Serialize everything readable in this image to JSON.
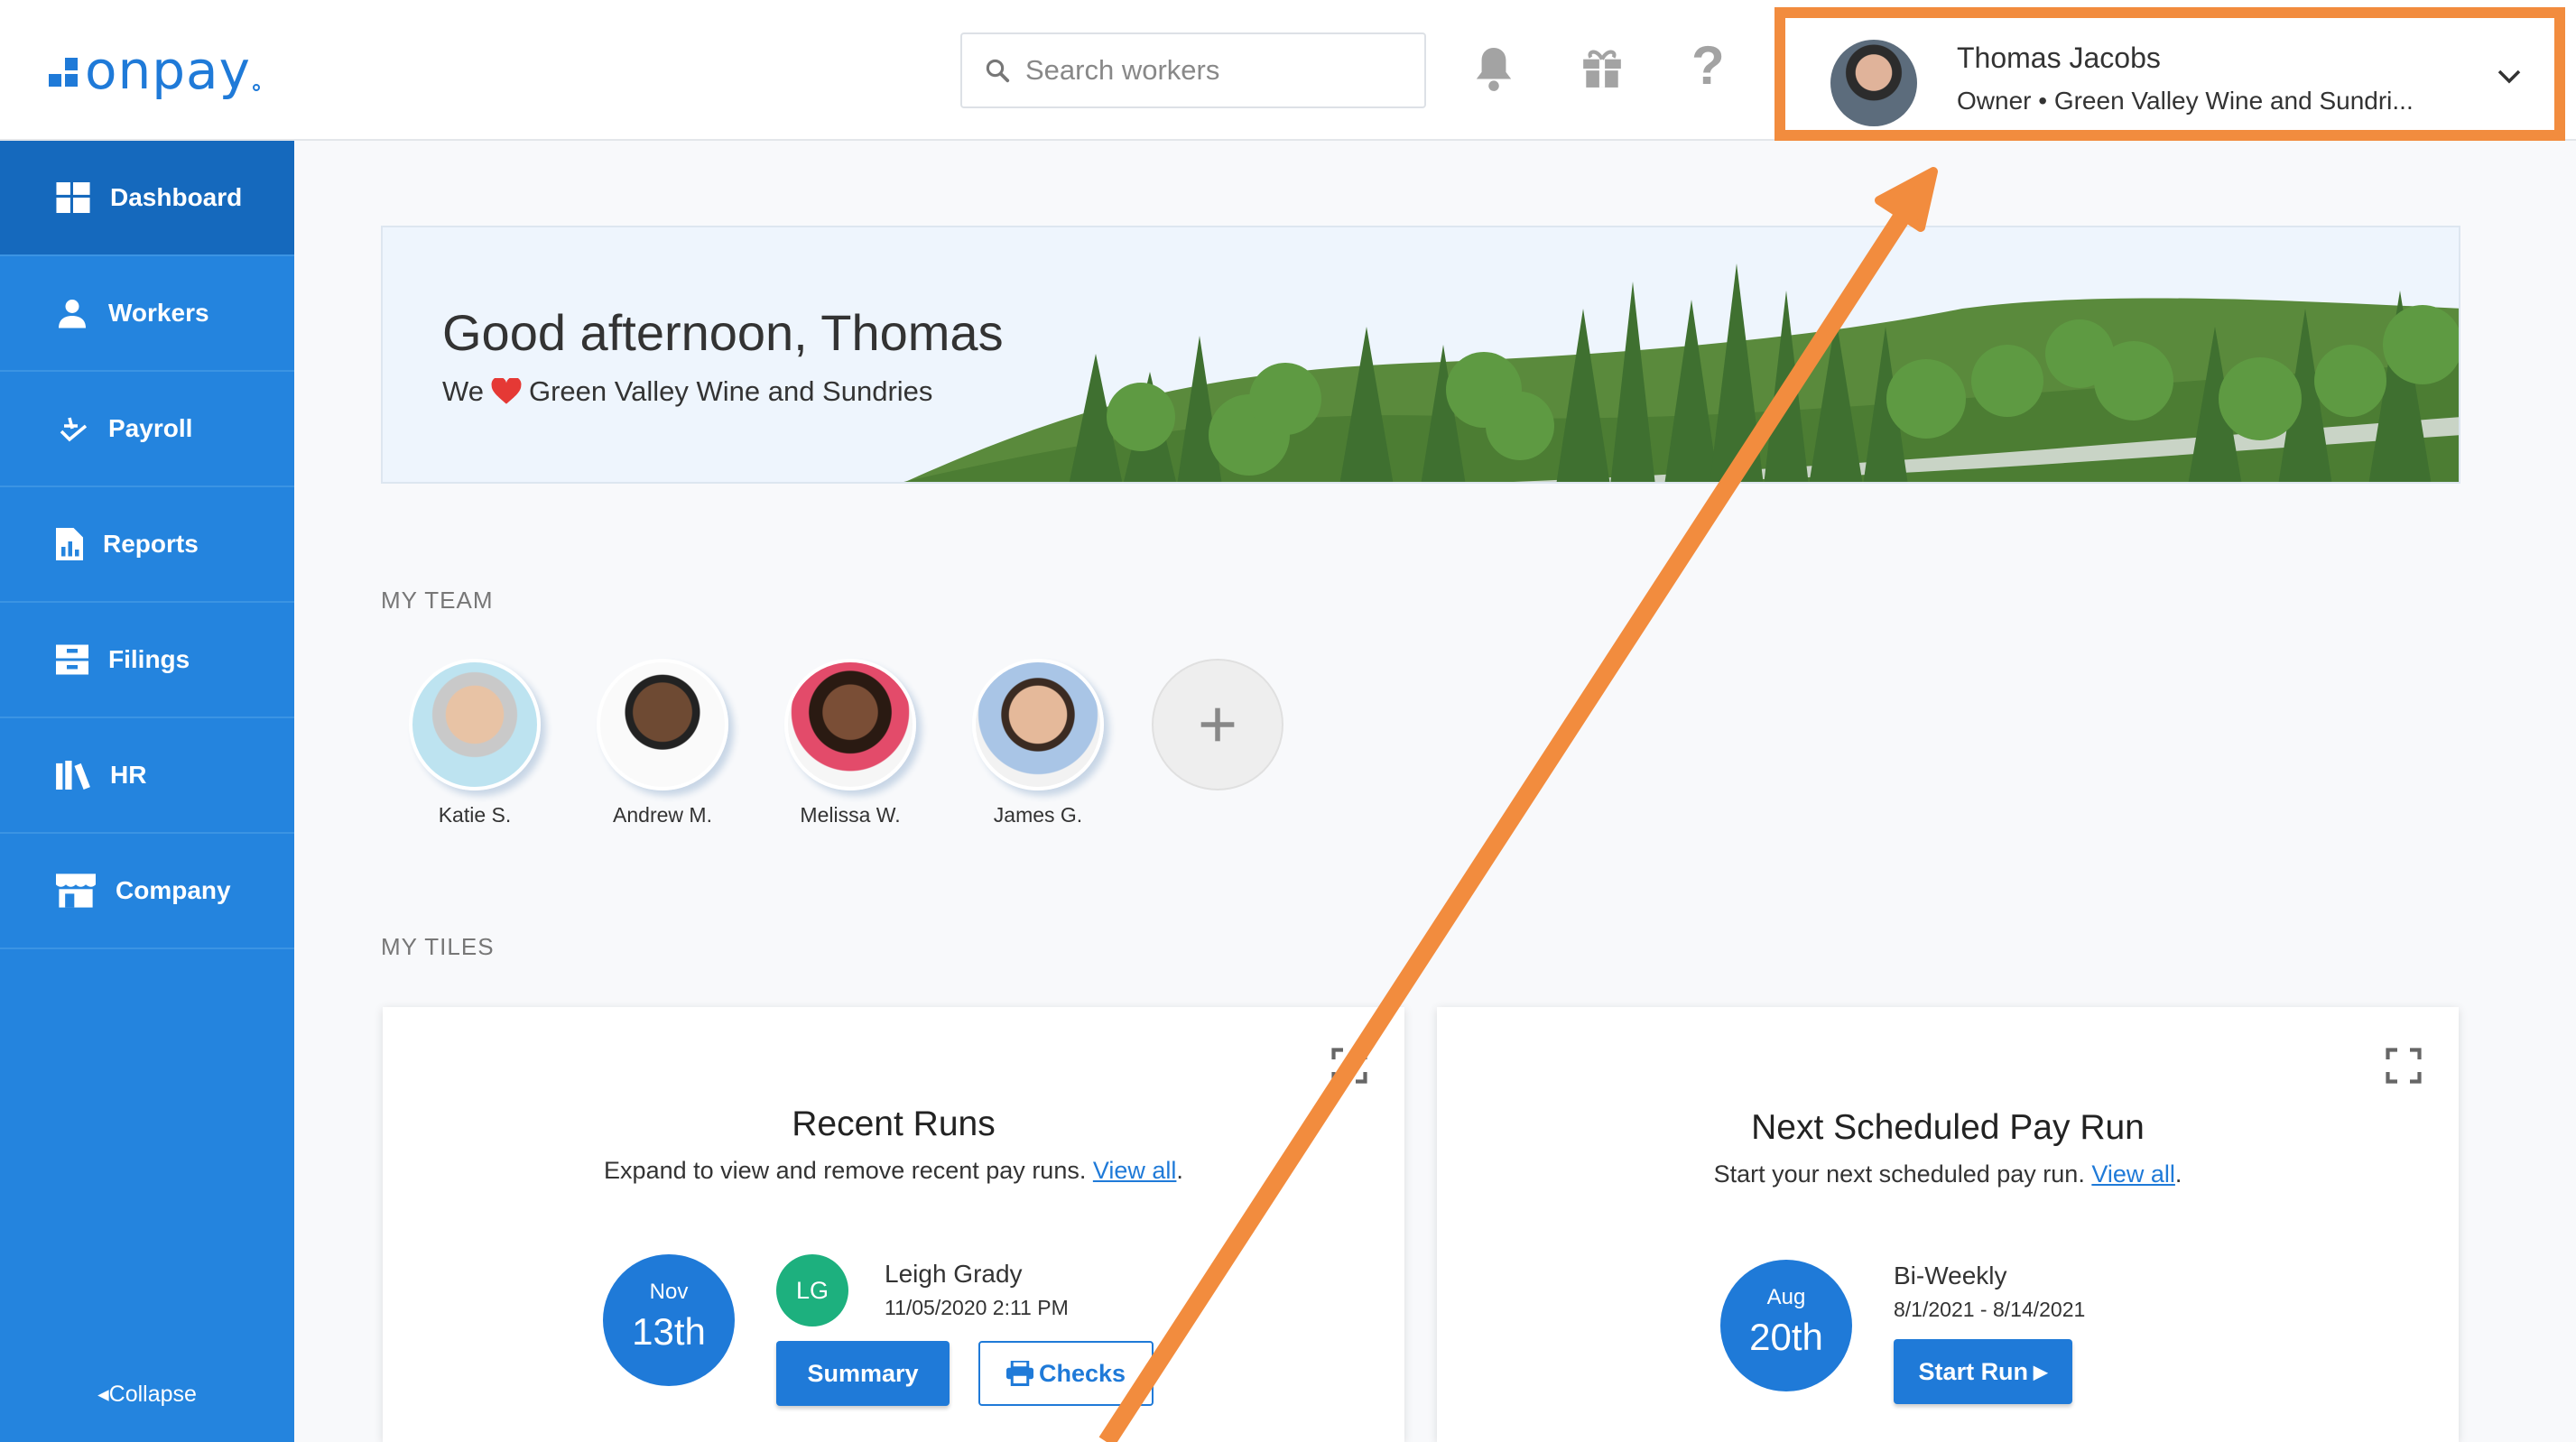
{
  "brand": {
    "name": "onpay",
    "color": "#1f7ad8"
  },
  "header": {
    "search_placeholder": "Search workers",
    "icons": [
      "bell-icon",
      "gift-icon",
      "help-icon"
    ]
  },
  "profile": {
    "name": "Thomas Jacobs",
    "role": "Owner • Green Valley Wine and Sundri...",
    "highlight_color": "#f28c3e"
  },
  "sidebar": {
    "items": [
      {
        "label": "Dashboard",
        "icon": "dashboard-icon",
        "active": true
      },
      {
        "label": "Workers",
        "icon": "workers-icon"
      },
      {
        "label": "Payroll",
        "icon": "payroll-icon"
      },
      {
        "label": "Reports",
        "icon": "reports-icon"
      },
      {
        "label": "Filings",
        "icon": "filings-icon"
      },
      {
        "label": "HR",
        "icon": "hr-icon"
      },
      {
        "label": "Company",
        "icon": "company-icon"
      }
    ],
    "collapse_label": "Collapse"
  },
  "banner": {
    "greeting": "Good afternoon, Thomas",
    "sub_prefix": "We",
    "sub_company": "Green Valley Wine and Sundries"
  },
  "team": {
    "label": "MY TEAM",
    "members": [
      {
        "name": "Katie S."
      },
      {
        "name": "Andrew M."
      },
      {
        "name": "Melissa W."
      },
      {
        "name": "James G."
      }
    ]
  },
  "tiles": {
    "label": "MY TILES",
    "recent_runs": {
      "title": "Recent Runs",
      "desc": "Expand to view and remove recent pay runs.",
      "link": "View all",
      "month": "Nov",
      "day": "13th",
      "initials": "LG",
      "person": "Leigh Grady",
      "timestamp": "11/05/2020 2:11 PM",
      "summary_label": "Summary",
      "checks_label": "Checks"
    },
    "next_run": {
      "title": "Next Scheduled Pay Run",
      "desc": "Start your next scheduled pay run.",
      "link": "View all",
      "month": "Aug",
      "day": "20th",
      "frequency": "Bi-Weekly",
      "period": "8/1/2021 - 8/14/2021",
      "start_label": "Start Run"
    }
  }
}
